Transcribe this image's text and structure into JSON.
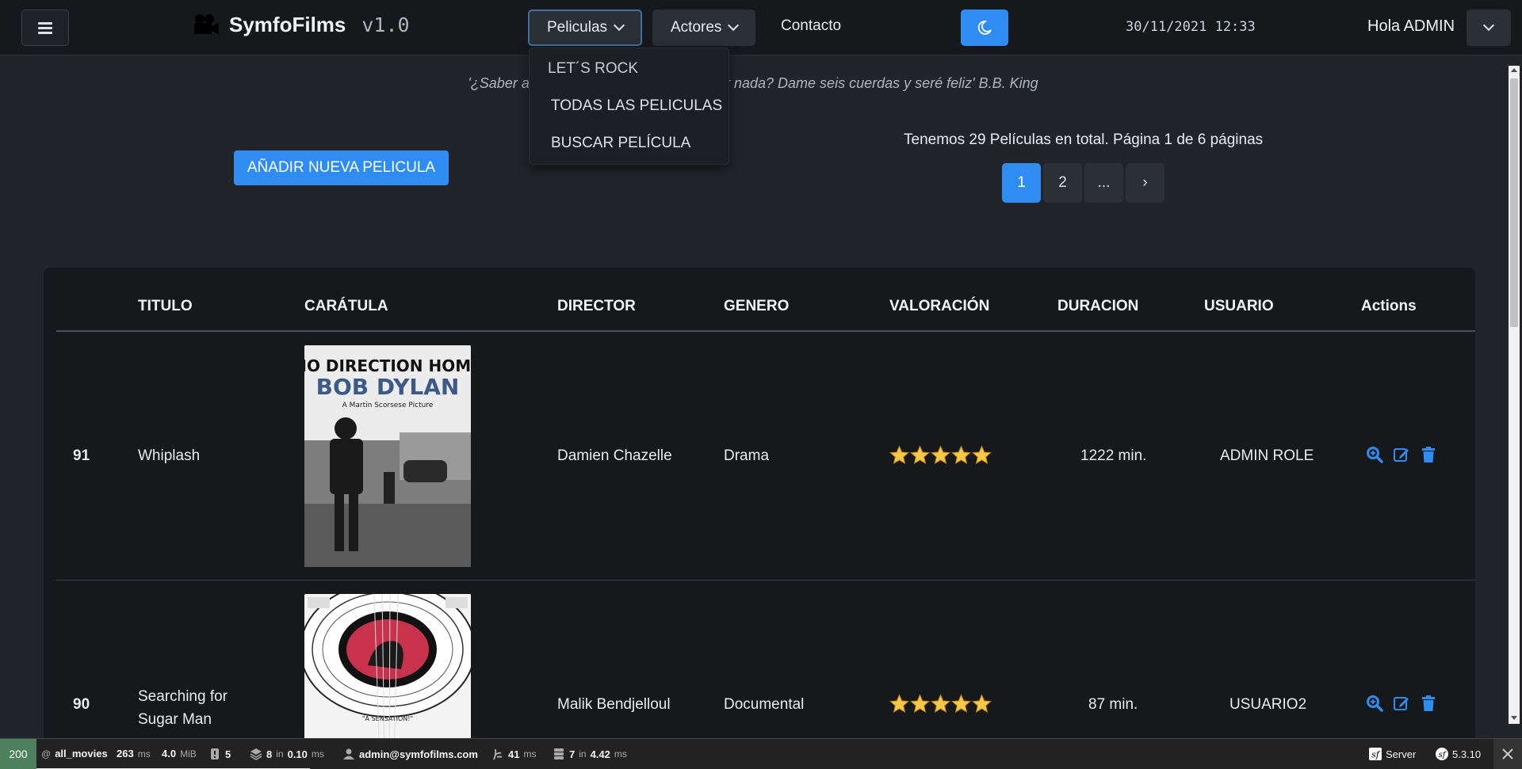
{
  "navbar": {
    "brand_name": "SymfoFilms",
    "brand_version": "v1.0",
    "menu_peliculas": "Peliculas",
    "menu_actores": "Actores",
    "menu_contacto": "Contacto",
    "datetime": "30/11/2021 12:33",
    "greeting": "Hola ADMIN",
    "accent_color": "#2f8cf2"
  },
  "dropdown": {
    "items": [
      "LET´S ROCK",
      "TODAS LAS PELICULAS",
      "BUSCAR PELÍCULA"
    ]
  },
  "quote": "'¿Saber algo de guitarra te hace imaginar nada? Dame seis cuerdas y seré feliz' B.B. King",
  "add_button": "AÑADIR NUEVA PELICULA",
  "summary": "Tenemos 29 Películas en total. Página 1 de 6 páginas",
  "pagination": [
    "1",
    "2",
    "...",
    "›"
  ],
  "table": {
    "headers": [
      "TITULO",
      "CARÁTULA",
      "DIRECTOR",
      "GENERO",
      "VALORACIÓN",
      "DURACION",
      "USUARIO",
      "Actions"
    ],
    "rows": [
      {
        "id": "91",
        "title": "Whiplash",
        "cover_text": [
          "NO DIRECTION HOME",
          "BOB DYLAN",
          "A Martin Scorsese Picture"
        ],
        "director": "Damien Chazelle",
        "genre": "Drama",
        "rating": 5,
        "duration": "1222 min.",
        "user": "ADMIN ROLE"
      },
      {
        "id": "90",
        "title": "Searching for Sugar Man",
        "cover_text": [
          "\"A SENSATION!\""
        ],
        "director": "Malik Bendjelloul",
        "genre": "Documental",
        "rating": 5,
        "duration": "87 min.",
        "user": "USUARIO2"
      }
    ]
  },
  "toolbar": {
    "status": "200",
    "route": "all_movies",
    "time": "263",
    "time_unit": "ms",
    "memory": "4.0",
    "memory_unit": "MiB",
    "logs": "5",
    "cache_count": "8",
    "cache_in": "in",
    "cache_time": "0.10",
    "cache_unit": "ms",
    "user": "admin@symfofilms.com",
    "twig_time": "41",
    "twig_unit": "ms",
    "db_count": "7",
    "db_in": "in",
    "db_time": "4.42",
    "db_unit": "ms",
    "server": "Server",
    "version": "5.3.10"
  }
}
